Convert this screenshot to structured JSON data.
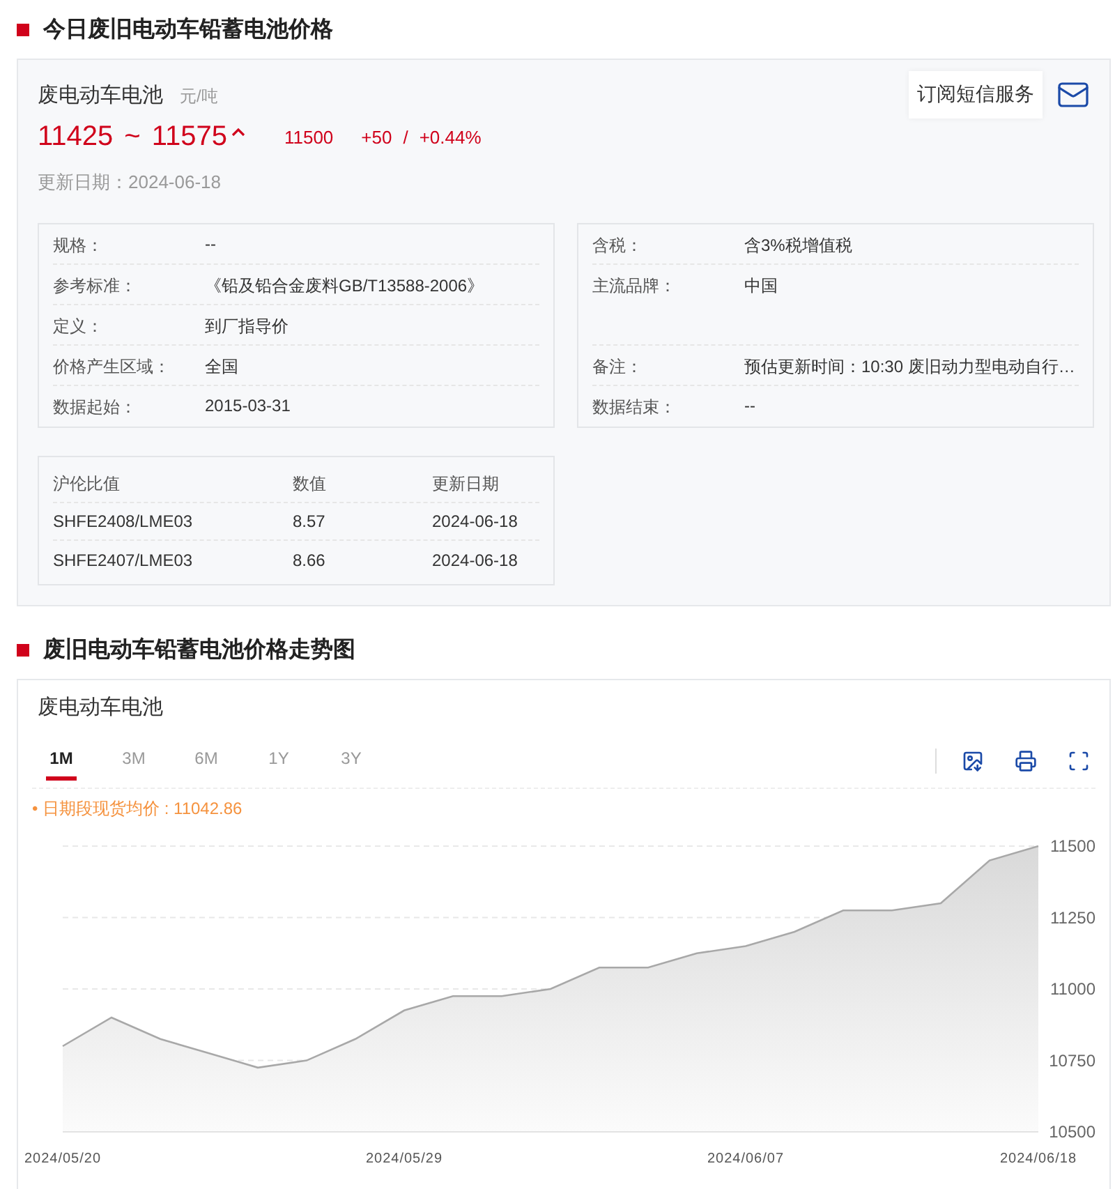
{
  "price_section": {
    "title": "今日废旧电动车铅蓄电池价格",
    "product": "废电动车电池",
    "unit": "元/吨",
    "subscribe": "订阅短信服务",
    "low": "11425",
    "tilde": "~",
    "high": "11575",
    "average": "11500",
    "change": "+50",
    "slash": "/",
    "change_pct": "+0.44%",
    "updated": "更新日期：2024-06-18",
    "specs_left": [
      {
        "label": "规格：",
        "value": "--"
      },
      {
        "label": "参考标准：",
        "value": "《铅及铅合金废料GB/T13588-2006》"
      },
      {
        "label": "定义：",
        "value": "到厂指导价"
      },
      {
        "label": "价格产生区域：",
        "value": "全国"
      },
      {
        "label": "数据起始：",
        "value": "2015-03-31"
      }
    ],
    "specs_right": [
      {
        "label": "含税：",
        "value": "含3%税增值税"
      },
      {
        "label": "主流品牌：",
        "value": "中国"
      },
      {
        "label": "备注：",
        "value": "预估更新时间：10:30 废旧动力型电动自行…"
      },
      {
        "label": "数据结束：",
        "value": "--"
      }
    ],
    "ratio_table": {
      "columns": [
        "沪伦比值",
        "数值",
        "更新日期"
      ],
      "rows": [
        [
          "SHFE2408/LME03",
          "8.57",
          "2024-06-18"
        ],
        [
          "SHFE2407/LME03",
          "8.66",
          "2024-06-18"
        ]
      ]
    }
  },
  "chart_section": {
    "title": "废旧电动车铅蓄电池价格走势图",
    "product": "废电动车电池",
    "ranges": [
      {
        "label": "1M",
        "selected": true
      },
      {
        "label": "3M",
        "selected": false
      },
      {
        "label": "6M",
        "selected": false
      },
      {
        "label": "1Y",
        "selected": false
      },
      {
        "label": "3Y",
        "selected": false
      }
    ],
    "bullet": "•",
    "average_note": "日期段现货均价 : 11042.86",
    "chart_data": {
      "type": "area",
      "categories": [
        "2024/05/20",
        null,
        null,
        null,
        null,
        null,
        null,
        "2024/05/29",
        null,
        null,
        null,
        null,
        null,
        null,
        "2024/06/07",
        null,
        null,
        null,
        null,
        null,
        "2024/06/18"
      ],
      "series": [
        {
          "color": "#a8a8a8",
          "values": [
            10800,
            10900,
            10825,
            10775,
            10725,
            10750,
            10825,
            10925,
            10975,
            10975,
            11000,
            11075,
            11075,
            11125,
            11150,
            11200,
            11275,
            11275,
            11300,
            11450,
            11500
          ]
        }
      ],
      "ylim": [
        10500,
        11500
      ],
      "grid": true,
      "yticks": [
        10500,
        10750,
        11000,
        11250,
        11500
      ]
    }
  }
}
